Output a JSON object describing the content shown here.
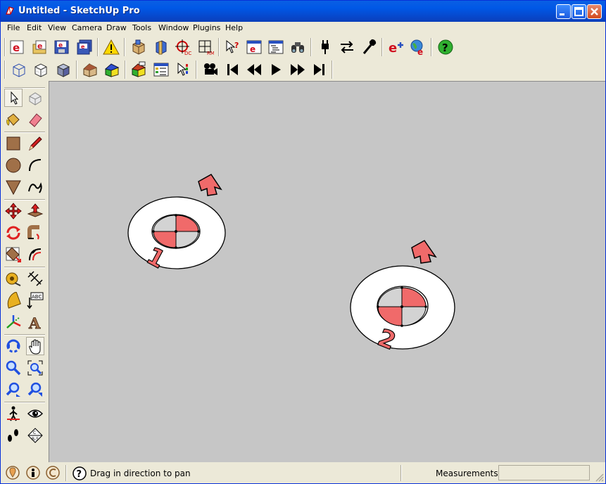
{
  "window": {
    "title": "Untitled - SketchUp Pro"
  },
  "menu": [
    "File",
    "Edit",
    "View",
    "Camera",
    "Draw",
    "Tools",
    "Window",
    "Plugins",
    "Help"
  ],
  "toolbar_top": [
    "explorer-e-icon",
    "explorer-open-icon",
    "explorer-save-icon",
    "explorer-saveas-icon",
    "warning-icon",
    "component-icon",
    "cube-section-icon",
    "section-plane-icon",
    "grid-icon",
    "whats-this-icon",
    "explorer-window-icon",
    "outliner-icon",
    "binoculars-icon",
    "plug-icon",
    "swap-arrows-icon",
    "wrench-icon",
    "e-plus-icon",
    "globe-e-icon",
    "help-icon"
  ],
  "toolbar_second": [
    "wireframe-cube-icon",
    "hidden-line-cube-icon",
    "shaded-cube-icon",
    "house-icon",
    "colored-house-icon",
    "house-warehouse-icon",
    "layer-grid-icon",
    "cursor-color-icon",
    "movie-camera-icon",
    "first-frame-icon",
    "rewind-icon",
    "play-icon",
    "fast-forward-icon",
    "last-frame-icon"
  ],
  "left_tools": [
    [
      "select-arrow-icon",
      "make-component-icon"
    ],
    [
      "paint-bucket-icon",
      "eraser-icon"
    ],
    [
      "rectangle-icon",
      "pencil-icon"
    ],
    [
      "circle-icon",
      "arc-icon"
    ],
    [
      "polygon-icon",
      "freehand-icon"
    ],
    [
      "move-icon",
      "push-pull-icon"
    ],
    [
      "rotate-icon",
      "follow-me-icon"
    ],
    [
      "scale-icon",
      "offset-icon"
    ],
    [
      "tape-measure-icon",
      "dimension-icon"
    ],
    [
      "protractor-icon",
      "text-label-icon"
    ],
    [
      "axes-icon",
      "3d-text-icon"
    ],
    [
      "orbit-icon",
      "pan-hand-icon"
    ],
    [
      "zoom-icon",
      "zoom-window-icon"
    ],
    [
      "previous-view-icon",
      "next-view-icon"
    ],
    [
      "walk-icon",
      "look-around-icon"
    ],
    [
      "footprints-icon",
      "section-symbol-icon"
    ]
  ],
  "left_text_icon_label": "ABC",
  "scene": {
    "markers": [
      {
        "label": "1"
      },
      {
        "label": "2"
      }
    ]
  },
  "status": {
    "icons": [
      "geo-location-icon",
      "credits-icon",
      "copyright-icon",
      "question-icon"
    ],
    "message": "Drag in direction to pan",
    "measurements_label": "Measurements",
    "measurements_value": ""
  }
}
